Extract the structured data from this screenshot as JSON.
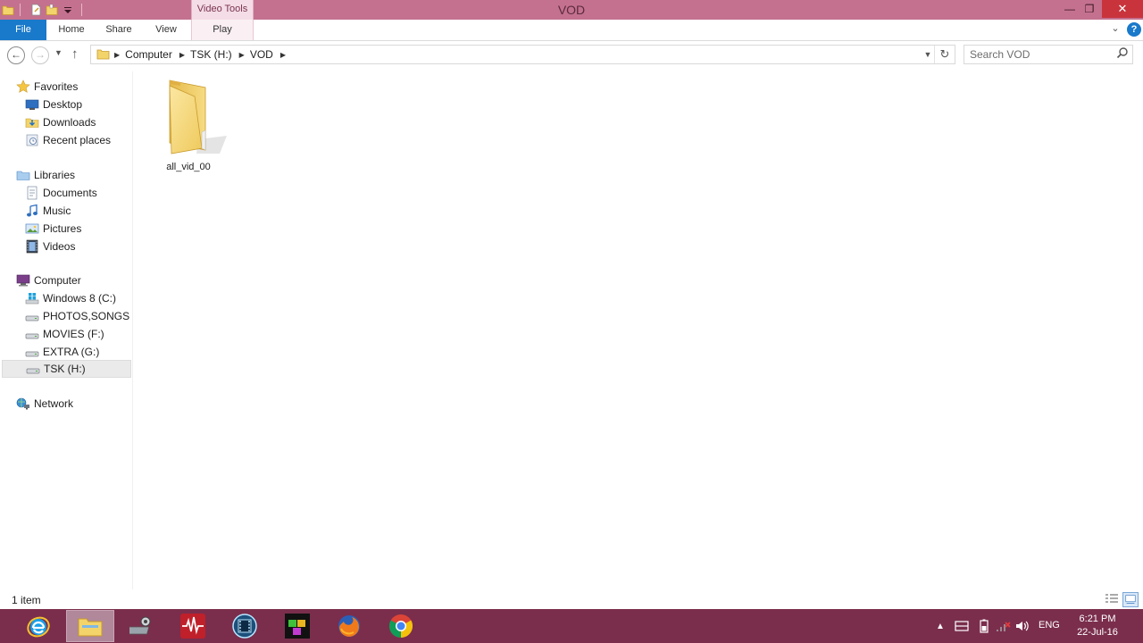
{
  "window": {
    "title": "VOD",
    "minimize_glyph": "—",
    "maximize_glyph": "❐",
    "close_glyph": "✕"
  },
  "ribbon": {
    "contextual_group": "Video Tools",
    "tabs": {
      "file": "File",
      "home": "Home",
      "share": "Share",
      "view": "View",
      "play": "Play"
    },
    "expand_glyph": "⌄",
    "help_glyph": "?"
  },
  "nav": {
    "back_glyph": "←",
    "forward_glyph": "→",
    "recent_glyph": "▼",
    "up_glyph": "↑",
    "breadcrumbs": [
      "Computer",
      "TSK (H:)",
      "VOD"
    ],
    "dropdown_glyph": "▼",
    "refresh_glyph": "↻"
  },
  "search": {
    "placeholder": "Search VOD"
  },
  "sidebar": {
    "favorites": {
      "label": "Favorites",
      "items": [
        "Desktop",
        "Downloads",
        "Recent places"
      ]
    },
    "libraries": {
      "label": "Libraries",
      "items": [
        "Documents",
        "Music",
        "Pictures",
        "Videos"
      ]
    },
    "computer": {
      "label": "Computer",
      "items": [
        "Windows 8 (C:)",
        "PHOTOS,SONGS & VIDEOS",
        "MOVIES (F:)",
        "EXTRA (G:)",
        "TSK (H:)"
      ],
      "selected": "TSK (H:)"
    },
    "network": {
      "label": "Network"
    }
  },
  "content": {
    "items": [
      {
        "name": "all_vid_00",
        "icon": "folder-icon"
      }
    ]
  },
  "status": {
    "item_count": "1 item"
  },
  "taskbar": {
    "apps": [
      "internet-explorer-icon",
      "file-explorer-icon",
      "system-tool-icon",
      "audio-editor-icon",
      "media-player-icon",
      "video-editor-icon",
      "firefox-icon",
      "chrome-icon"
    ],
    "language": "ENG",
    "time": "6:21 PM",
    "date": "22-Jul-16"
  },
  "colors": {
    "titlebar": "#c4718f",
    "file_tab": "#1979ca",
    "taskbar": "#7a2e4c",
    "close": "#c9343c"
  }
}
